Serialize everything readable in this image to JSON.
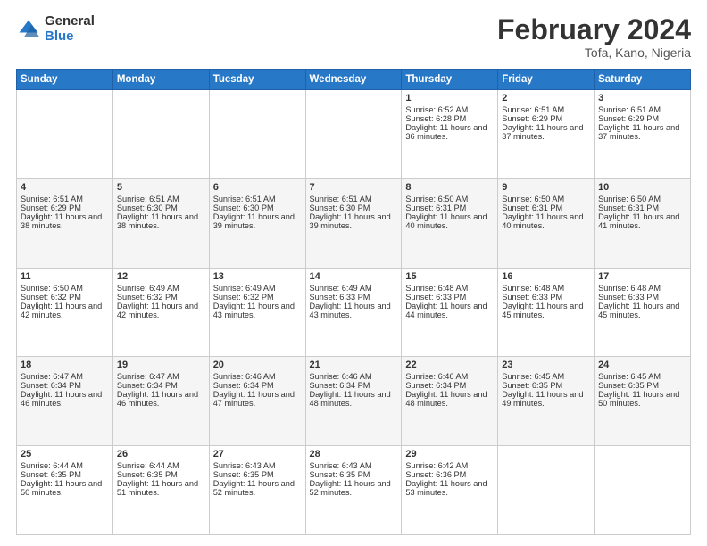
{
  "header": {
    "logo_general": "General",
    "logo_blue": "Blue",
    "month_title": "February 2024",
    "subtitle": "Tofa, Kano, Nigeria"
  },
  "days_of_week": [
    "Sunday",
    "Monday",
    "Tuesday",
    "Wednesday",
    "Thursday",
    "Friday",
    "Saturday"
  ],
  "weeks": [
    [
      {
        "day": "",
        "info": ""
      },
      {
        "day": "",
        "info": ""
      },
      {
        "day": "",
        "info": ""
      },
      {
        "day": "",
        "info": ""
      },
      {
        "day": "1",
        "info": "Sunrise: 6:52 AM\nSunset: 6:28 PM\nDaylight: 11 hours and 36 minutes."
      },
      {
        "day": "2",
        "info": "Sunrise: 6:51 AM\nSunset: 6:29 PM\nDaylight: 11 hours and 37 minutes."
      },
      {
        "day": "3",
        "info": "Sunrise: 6:51 AM\nSunset: 6:29 PM\nDaylight: 11 hours and 37 minutes."
      }
    ],
    [
      {
        "day": "4",
        "info": "Sunrise: 6:51 AM\nSunset: 6:29 PM\nDaylight: 11 hours and 38 minutes."
      },
      {
        "day": "5",
        "info": "Sunrise: 6:51 AM\nSunset: 6:30 PM\nDaylight: 11 hours and 38 minutes."
      },
      {
        "day": "6",
        "info": "Sunrise: 6:51 AM\nSunset: 6:30 PM\nDaylight: 11 hours and 39 minutes."
      },
      {
        "day": "7",
        "info": "Sunrise: 6:51 AM\nSunset: 6:30 PM\nDaylight: 11 hours and 39 minutes."
      },
      {
        "day": "8",
        "info": "Sunrise: 6:50 AM\nSunset: 6:31 PM\nDaylight: 11 hours and 40 minutes."
      },
      {
        "day": "9",
        "info": "Sunrise: 6:50 AM\nSunset: 6:31 PM\nDaylight: 11 hours and 40 minutes."
      },
      {
        "day": "10",
        "info": "Sunrise: 6:50 AM\nSunset: 6:31 PM\nDaylight: 11 hours and 41 minutes."
      }
    ],
    [
      {
        "day": "11",
        "info": "Sunrise: 6:50 AM\nSunset: 6:32 PM\nDaylight: 11 hours and 42 minutes."
      },
      {
        "day": "12",
        "info": "Sunrise: 6:49 AM\nSunset: 6:32 PM\nDaylight: 11 hours and 42 minutes."
      },
      {
        "day": "13",
        "info": "Sunrise: 6:49 AM\nSunset: 6:32 PM\nDaylight: 11 hours and 43 minutes."
      },
      {
        "day": "14",
        "info": "Sunrise: 6:49 AM\nSunset: 6:33 PM\nDaylight: 11 hours and 43 minutes."
      },
      {
        "day": "15",
        "info": "Sunrise: 6:48 AM\nSunset: 6:33 PM\nDaylight: 11 hours and 44 minutes."
      },
      {
        "day": "16",
        "info": "Sunrise: 6:48 AM\nSunset: 6:33 PM\nDaylight: 11 hours and 45 minutes."
      },
      {
        "day": "17",
        "info": "Sunrise: 6:48 AM\nSunset: 6:33 PM\nDaylight: 11 hours and 45 minutes."
      }
    ],
    [
      {
        "day": "18",
        "info": "Sunrise: 6:47 AM\nSunset: 6:34 PM\nDaylight: 11 hours and 46 minutes."
      },
      {
        "day": "19",
        "info": "Sunrise: 6:47 AM\nSunset: 6:34 PM\nDaylight: 11 hours and 46 minutes."
      },
      {
        "day": "20",
        "info": "Sunrise: 6:46 AM\nSunset: 6:34 PM\nDaylight: 11 hours and 47 minutes."
      },
      {
        "day": "21",
        "info": "Sunrise: 6:46 AM\nSunset: 6:34 PM\nDaylight: 11 hours and 48 minutes."
      },
      {
        "day": "22",
        "info": "Sunrise: 6:46 AM\nSunset: 6:34 PM\nDaylight: 11 hours and 48 minutes."
      },
      {
        "day": "23",
        "info": "Sunrise: 6:45 AM\nSunset: 6:35 PM\nDaylight: 11 hours and 49 minutes."
      },
      {
        "day": "24",
        "info": "Sunrise: 6:45 AM\nSunset: 6:35 PM\nDaylight: 11 hours and 50 minutes."
      }
    ],
    [
      {
        "day": "25",
        "info": "Sunrise: 6:44 AM\nSunset: 6:35 PM\nDaylight: 11 hours and 50 minutes."
      },
      {
        "day": "26",
        "info": "Sunrise: 6:44 AM\nSunset: 6:35 PM\nDaylight: 11 hours and 51 minutes."
      },
      {
        "day": "27",
        "info": "Sunrise: 6:43 AM\nSunset: 6:35 PM\nDaylight: 11 hours and 52 minutes."
      },
      {
        "day": "28",
        "info": "Sunrise: 6:43 AM\nSunset: 6:35 PM\nDaylight: 11 hours and 52 minutes."
      },
      {
        "day": "29",
        "info": "Sunrise: 6:42 AM\nSunset: 6:36 PM\nDaylight: 11 hours and 53 minutes."
      },
      {
        "day": "",
        "info": ""
      },
      {
        "day": "",
        "info": ""
      }
    ]
  ]
}
